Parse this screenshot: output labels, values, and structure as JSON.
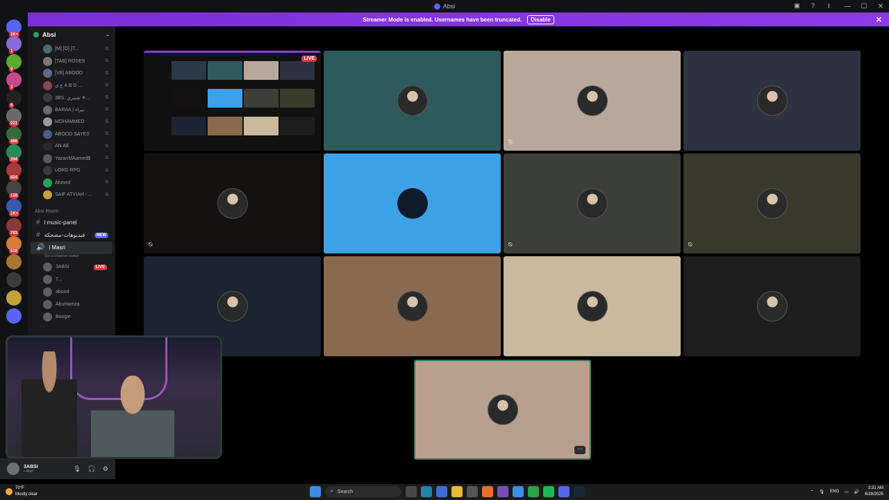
{
  "window": {
    "title": "Absi"
  },
  "banner": {
    "text": "Streamer Mode is enabled. Usernames have been truncated.",
    "button": "Disable"
  },
  "guild_badges": [
    "1K+",
    "1",
    "9",
    "3",
    "6",
    "921",
    "486",
    "394",
    "824",
    "128",
    "1K+",
    "783",
    "518"
  ],
  "server": {
    "name": "Absi"
  },
  "members": [
    "[M] [O] [T...",
    "[TAB] ROSES",
    "[VB] ABOOD",
    "ع ي A B D ...",
    "3BS. شمري ⚜...",
    "BARAA | بيراء",
    "MOHAMMED",
    "ABOOD SAYES",
    "AN AE",
    "YazanMAamed$",
    "LORD RPG",
    "Ahmed",
    "SAIF ATYIAH - ..."
  ],
  "category": "Absi Room",
  "channels": [
    {
      "name": "l music-panel",
      "badge": ""
    },
    {
      "name": "فيديوهات-مضحكة",
      "badge": "NEW"
    }
  ],
  "voice_channel": {
    "name": "l Masri",
    "status": "Set a channel status"
  },
  "voice_members": [
    {
      "name": "3ABSI",
      "live": "LIVE"
    },
    {
      "name": "7...",
      "live": ""
    },
    {
      "name": "abood",
      "live": ""
    },
    {
      "name": "AbuHamza",
      "live": ""
    },
    {
      "name": "Boogie",
      "live": ""
    }
  ],
  "stream_tile": {
    "live": "LIVE"
  },
  "tiles_more": "···",
  "user_panel": {
    "name": "3ABSI",
    "status": "• Absi"
  },
  "taskbar": {
    "search": "Search",
    "weather_temp": "70°F",
    "weather_desc": "Mostly clear",
    "lang": "ENG",
    "time": "3:31 AM",
    "date": "6/28/2025"
  },
  "colors": {
    "banner": "#8d3be8",
    "live": "#e4353c",
    "tile_highlight": "#3da1e6"
  }
}
